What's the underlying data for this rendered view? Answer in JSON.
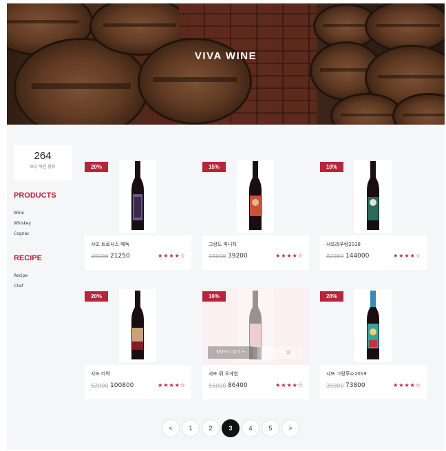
{
  "hero": {
    "title": "VIVA WINE"
  },
  "sidebar": {
    "count": "264",
    "count_label": "보유 와인 종류",
    "products_title": "PRODUCTS",
    "products": [
      "Wine",
      "Whiskey",
      "Cognac"
    ],
    "recipe_title": "RECIPE",
    "recipes": [
      "Recipe",
      "Chef"
    ]
  },
  "products": [
    {
      "badge": "20%",
      "name": "샤또 트로사스 메독",
      "old_price": "49000",
      "price": "21250",
      "stars": "★★★★☆",
      "label_color": "#6a5a8a"
    },
    {
      "badge": "15%",
      "name": "그랑도 파니차",
      "old_price": "25000",
      "price": "39200",
      "stars": "★★★★☆",
      "label_color": "#c8523a"
    },
    {
      "badge": "10%",
      "name": "샤또레푸랑2018",
      "old_price": "82000",
      "price": "144000",
      "stars": "★★★★☆",
      "label_color": "#2a6a5a"
    },
    {
      "badge": "20%",
      "name": "샤또 타약",
      "old_price": "52000",
      "price": "100800",
      "stars": "★★★★☆",
      "label_color": "#c8a07a"
    },
    {
      "badge": "10%",
      "name": "샤또 뒤 오게힌",
      "old_price": "55000",
      "price": "86400",
      "stars": "★★★★☆",
      "label_color": "#d89090",
      "hover": {
        "cart_label": "장바구니 담기 +",
        "buy_label": "바로 구매 🛒"
      }
    },
    {
      "badge": "20%",
      "name": "샤또 그랑루쇼2019",
      "old_price": "35000",
      "price": "73800",
      "stars": "★★★★☆",
      "label_color": "#3aa0a0"
    }
  ],
  "pagination": {
    "prev": "<",
    "pages": [
      "1",
      "2",
      "3",
      "4",
      "5"
    ],
    "active": "3",
    "next": ">"
  }
}
